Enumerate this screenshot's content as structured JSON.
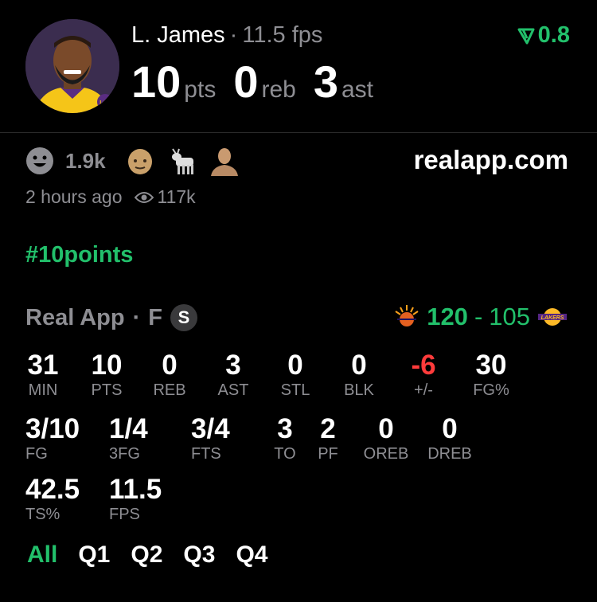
{
  "header": {
    "player_name": "L. James",
    "fps_label": "11.5 fps",
    "score_delta": "0.8",
    "headline": [
      {
        "value": "10",
        "unit": "pts"
      },
      {
        "value": "0",
        "unit": "reb"
      },
      {
        "value": "3",
        "unit": "ast"
      }
    ]
  },
  "reactions": {
    "count": "1.9k",
    "icons": [
      "smile-face-icon",
      "bald-face-icon",
      "goat-icon",
      "person-bust-icon"
    ]
  },
  "site": "realapp.com",
  "meta": {
    "time_ago": "2 hours ago",
    "views": "117k"
  },
  "hashtag": "#10points",
  "game": {
    "source": "Real App",
    "position": "F",
    "badge": "S",
    "score_home": "120",
    "score_sep": "-",
    "score_away": "105"
  },
  "stats": {
    "row1": [
      {
        "value": "31",
        "label": "MIN"
      },
      {
        "value": "10",
        "label": "PTS"
      },
      {
        "value": "0",
        "label": "REB"
      },
      {
        "value": "3",
        "label": "AST"
      },
      {
        "value": "0",
        "label": "STL"
      },
      {
        "value": "0",
        "label": "BLK"
      },
      {
        "value": "-6",
        "label": "+/-"
      },
      {
        "value": "30",
        "label": "FG%"
      }
    ],
    "row2": [
      {
        "value": "3/10",
        "label": "FG"
      },
      {
        "value": "1/4",
        "label": "3FG"
      },
      {
        "value": "3/4",
        "label": "FTS"
      },
      {
        "value": "3",
        "label": "TO"
      },
      {
        "value": "2",
        "label": "PF"
      },
      {
        "value": "0",
        "label": "OREB"
      },
      {
        "value": "0",
        "label": "DREB"
      }
    ],
    "row3": [
      {
        "value": "42.5",
        "label": "TS%"
      },
      {
        "value": "11.5",
        "label": "FPS"
      }
    ]
  },
  "tabs": [
    "All",
    "Q1",
    "Q2",
    "Q3",
    "Q4"
  ],
  "colors": {
    "accent": "#22c06b",
    "negative": "#ff3b3b",
    "muted": "#8e8e93",
    "background": "#000000"
  }
}
